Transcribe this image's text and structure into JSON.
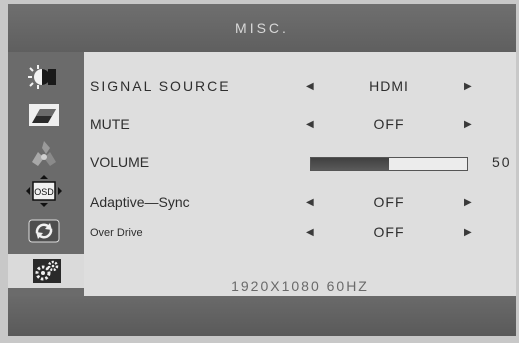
{
  "header": {
    "title": "MISC."
  },
  "sidebar": {
    "items": [
      {
        "icon": "brightness-icon"
      },
      {
        "icon": "image-icon"
      },
      {
        "icon": "color-icon"
      },
      {
        "icon": "osd-icon",
        "text": "OSD"
      },
      {
        "icon": "reset-icon"
      },
      {
        "icon": "misc-settings-icon",
        "active": true
      }
    ]
  },
  "menu": {
    "signal_source": {
      "label": "SIGNAL SOURCE",
      "value": "HDMI"
    },
    "mute": {
      "label": "MUTE",
      "value": "OFF"
    },
    "volume": {
      "label": "VOLUME",
      "value": "50",
      "level": 0.5
    },
    "adaptive_sync": {
      "label": "Adaptive—Sync",
      "value": "OFF"
    },
    "over_drive": {
      "label": "Over Drive",
      "value": "OFF"
    },
    "arrow_left": "◀",
    "arrow_right": "▶"
  },
  "status": {
    "resolution": "1920X1080 60HZ"
  },
  "colors": {
    "accent": "#6b6b6b",
    "panel": "#dedede",
    "text": "#2e2e2e"
  }
}
